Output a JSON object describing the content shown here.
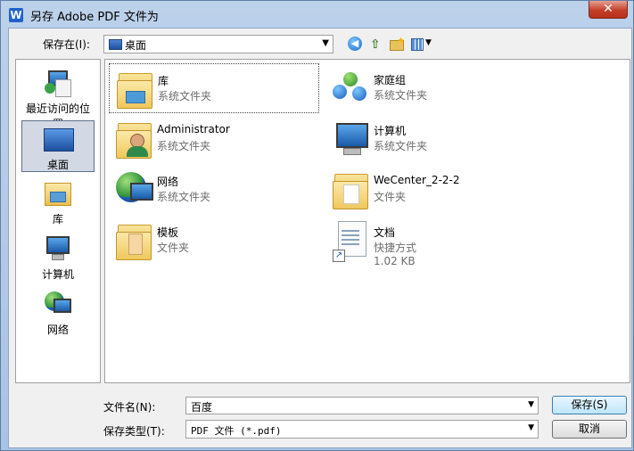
{
  "window": {
    "app_icon": "W",
    "title": "另存 Adobe PDF 文件为",
    "close_glyph": "✕"
  },
  "toolbar": {
    "save_in_label": "保存在(I):",
    "save_in_value": "桌面",
    "back_glyph": "◀",
    "up_glyph": "⇧",
    "views_arrow": "▼"
  },
  "places": [
    {
      "label": "最近访问的位置",
      "icon": "recent-places-icon"
    },
    {
      "label": "桌面",
      "icon": "desktop-icon"
    },
    {
      "label": "库",
      "icon": "library-icon"
    },
    {
      "label": "计算机",
      "icon": "computer-icon"
    },
    {
      "label": "网络",
      "icon": "network-icon"
    }
  ],
  "files": [
    {
      "name": "库",
      "type": "系统文件夹",
      "icon": "library-icon"
    },
    {
      "name": "家庭组",
      "type": "系统文件夹",
      "icon": "homegroup-icon"
    },
    {
      "name": "Administrator",
      "type": "系统文件夹",
      "icon": "user-folder-icon"
    },
    {
      "name": "计算机",
      "type": "系统文件夹",
      "icon": "computer-icon"
    },
    {
      "name": "网络",
      "type": "系统文件夹",
      "icon": "network-icon"
    },
    {
      "name": "WeCenter_2-2-2",
      "type": "文件夹",
      "icon": "folder-icon"
    },
    {
      "name": "模板",
      "type": "文件夹",
      "icon": "folder-icon"
    },
    {
      "name": "文档",
      "type": "快捷方式",
      "size": "1.02 KB",
      "icon": "shortcut-icon"
    }
  ],
  "form": {
    "filename_label": "文件名(N):",
    "filename_value": "百度",
    "filetype_label": "保存类型(T):",
    "filetype_value": "PDF 文件 (*.pdf)",
    "save_button": "保存(S)",
    "cancel_button": "取消"
  }
}
